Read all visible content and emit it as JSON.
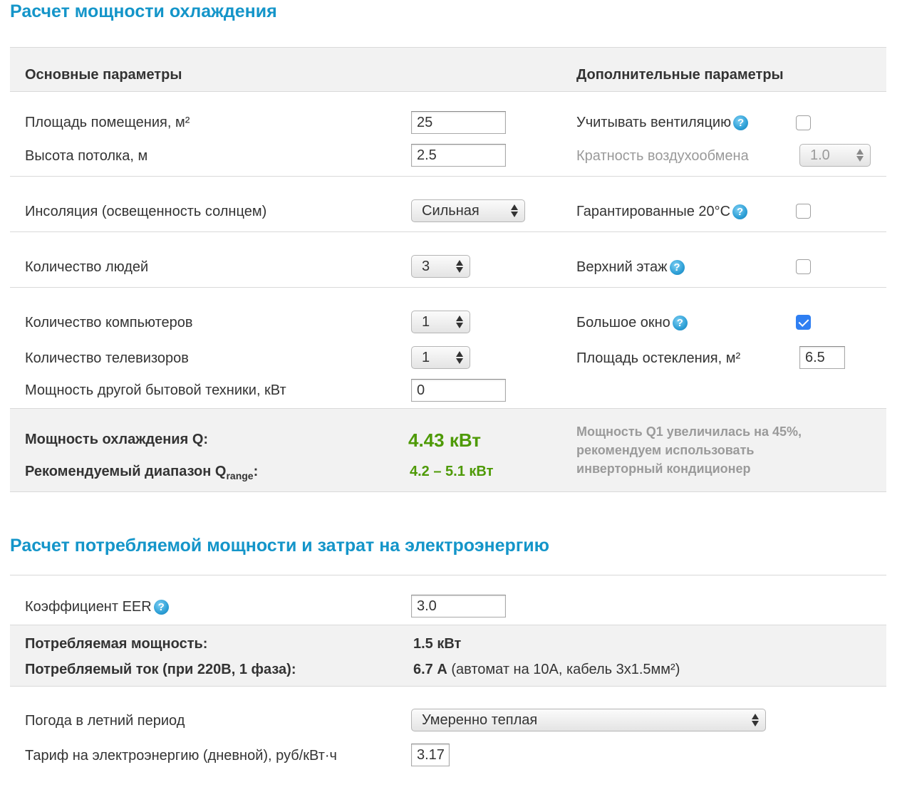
{
  "cooling": {
    "title": "Расчет мощности охлаждения",
    "main_header": "Основные параметры",
    "extra_header": "Дополнительные параметры",
    "area": {
      "label": "Площадь помещения, м²",
      "value": "25"
    },
    "height": {
      "label": "Высота потолка, м",
      "value": "2.5"
    },
    "insolation": {
      "label": "Инсоляция (освещенность солнцем)",
      "value": "Сильная"
    },
    "people": {
      "label": "Количество людей",
      "value": "3"
    },
    "computers": {
      "label": "Количество компьютеров",
      "value": "1"
    },
    "tvs": {
      "label": "Количество телевизоров",
      "value": "1"
    },
    "appliances": {
      "label": "Мощность другой бытовой техники, кВт",
      "value": "0"
    },
    "ventilation": {
      "label": "Учитывать вентиляцию",
      "checked": false
    },
    "air_exchange": {
      "label": "Кратность воздухообмена",
      "value": "1.0"
    },
    "guaranteed": {
      "label": "Гарантированные 20°C",
      "checked": false
    },
    "top_floor": {
      "label": "Верхний этаж",
      "checked": false
    },
    "big_window": {
      "label": "Большое окно",
      "checked": true
    },
    "glazing": {
      "label": "Площадь остекления, м²",
      "value": "6.5"
    },
    "result": {
      "q_label": "Мощность охлаждения Q:",
      "q_value": "4.43 кВт",
      "range_label": "Рекомендуемый диапазон Q",
      "range_sub": "range",
      "range_colon": ":",
      "range_value": "4.2 – 5.1 кВт",
      "note_line1": "Мощность Q1 увеличилась на 45%,",
      "note_line2": "рекомендуем использовать",
      "note_line3": "инверторный кондиционер"
    }
  },
  "power": {
    "title": "Расчет потребляемой мощности и затрат на электроэнергию",
    "eer": {
      "label": "Коэффициент EER",
      "value": "3.0"
    },
    "consumption_label": "Потребляемая мощность:",
    "consumption_value": "1.5 кВт",
    "current_label": "Потребляемый ток (при 220В, 1 фаза):",
    "current_value": "6.7 А",
    "current_note": "(автомат на 10А, кабель 3х1.5мм²)",
    "weather": {
      "label": "Погода в летний период",
      "value": "Умеренно теплая"
    },
    "tariff": {
      "label": "Тариф на электроэнергию (дневной), руб/кВт·ч",
      "value": "3.17"
    }
  },
  "icons": {
    "help": "help-icon",
    "checkbox": "checkbox",
    "select_arrows": "select-arrows-icon"
  },
  "colors": {
    "heading": "#1495c9",
    "result": "#4e9a06",
    "checkbox_checked": "#2f7ff2",
    "help": "#2d9fd6"
  }
}
